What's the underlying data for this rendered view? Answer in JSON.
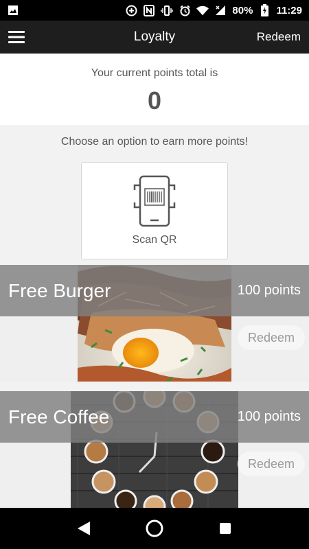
{
  "status_bar": {
    "battery": "80%",
    "time": "11:29",
    "icons": [
      "image-icon",
      "data-saver-icon",
      "nfc-icon",
      "vibrate-icon",
      "alarm-icon",
      "wifi-icon",
      "signal-icon",
      "battery-charging-icon"
    ]
  },
  "app_bar": {
    "title": "Loyalty",
    "redeem_label": "Redeem",
    "menu_icon": "hamburger-menu-icon"
  },
  "points": {
    "label": "Your current points total is",
    "value": "0"
  },
  "earn": {
    "label": "Choose an option to earn more points!",
    "scan_label": "Scan QR",
    "scan_icon": "phone-barcode-icon"
  },
  "rewards": [
    {
      "title": "Free Burger",
      "points": "100 points",
      "redeem_label": "Redeem",
      "image": "burger-photo"
    },
    {
      "title": "Free Coffee",
      "points": "100 points",
      "redeem_label": "Redeem",
      "image": "coffee-cups-photo"
    }
  ],
  "colors": {
    "app_bar": "#1e1e1e",
    "banner": "#808080",
    "text_muted": "#555555"
  }
}
